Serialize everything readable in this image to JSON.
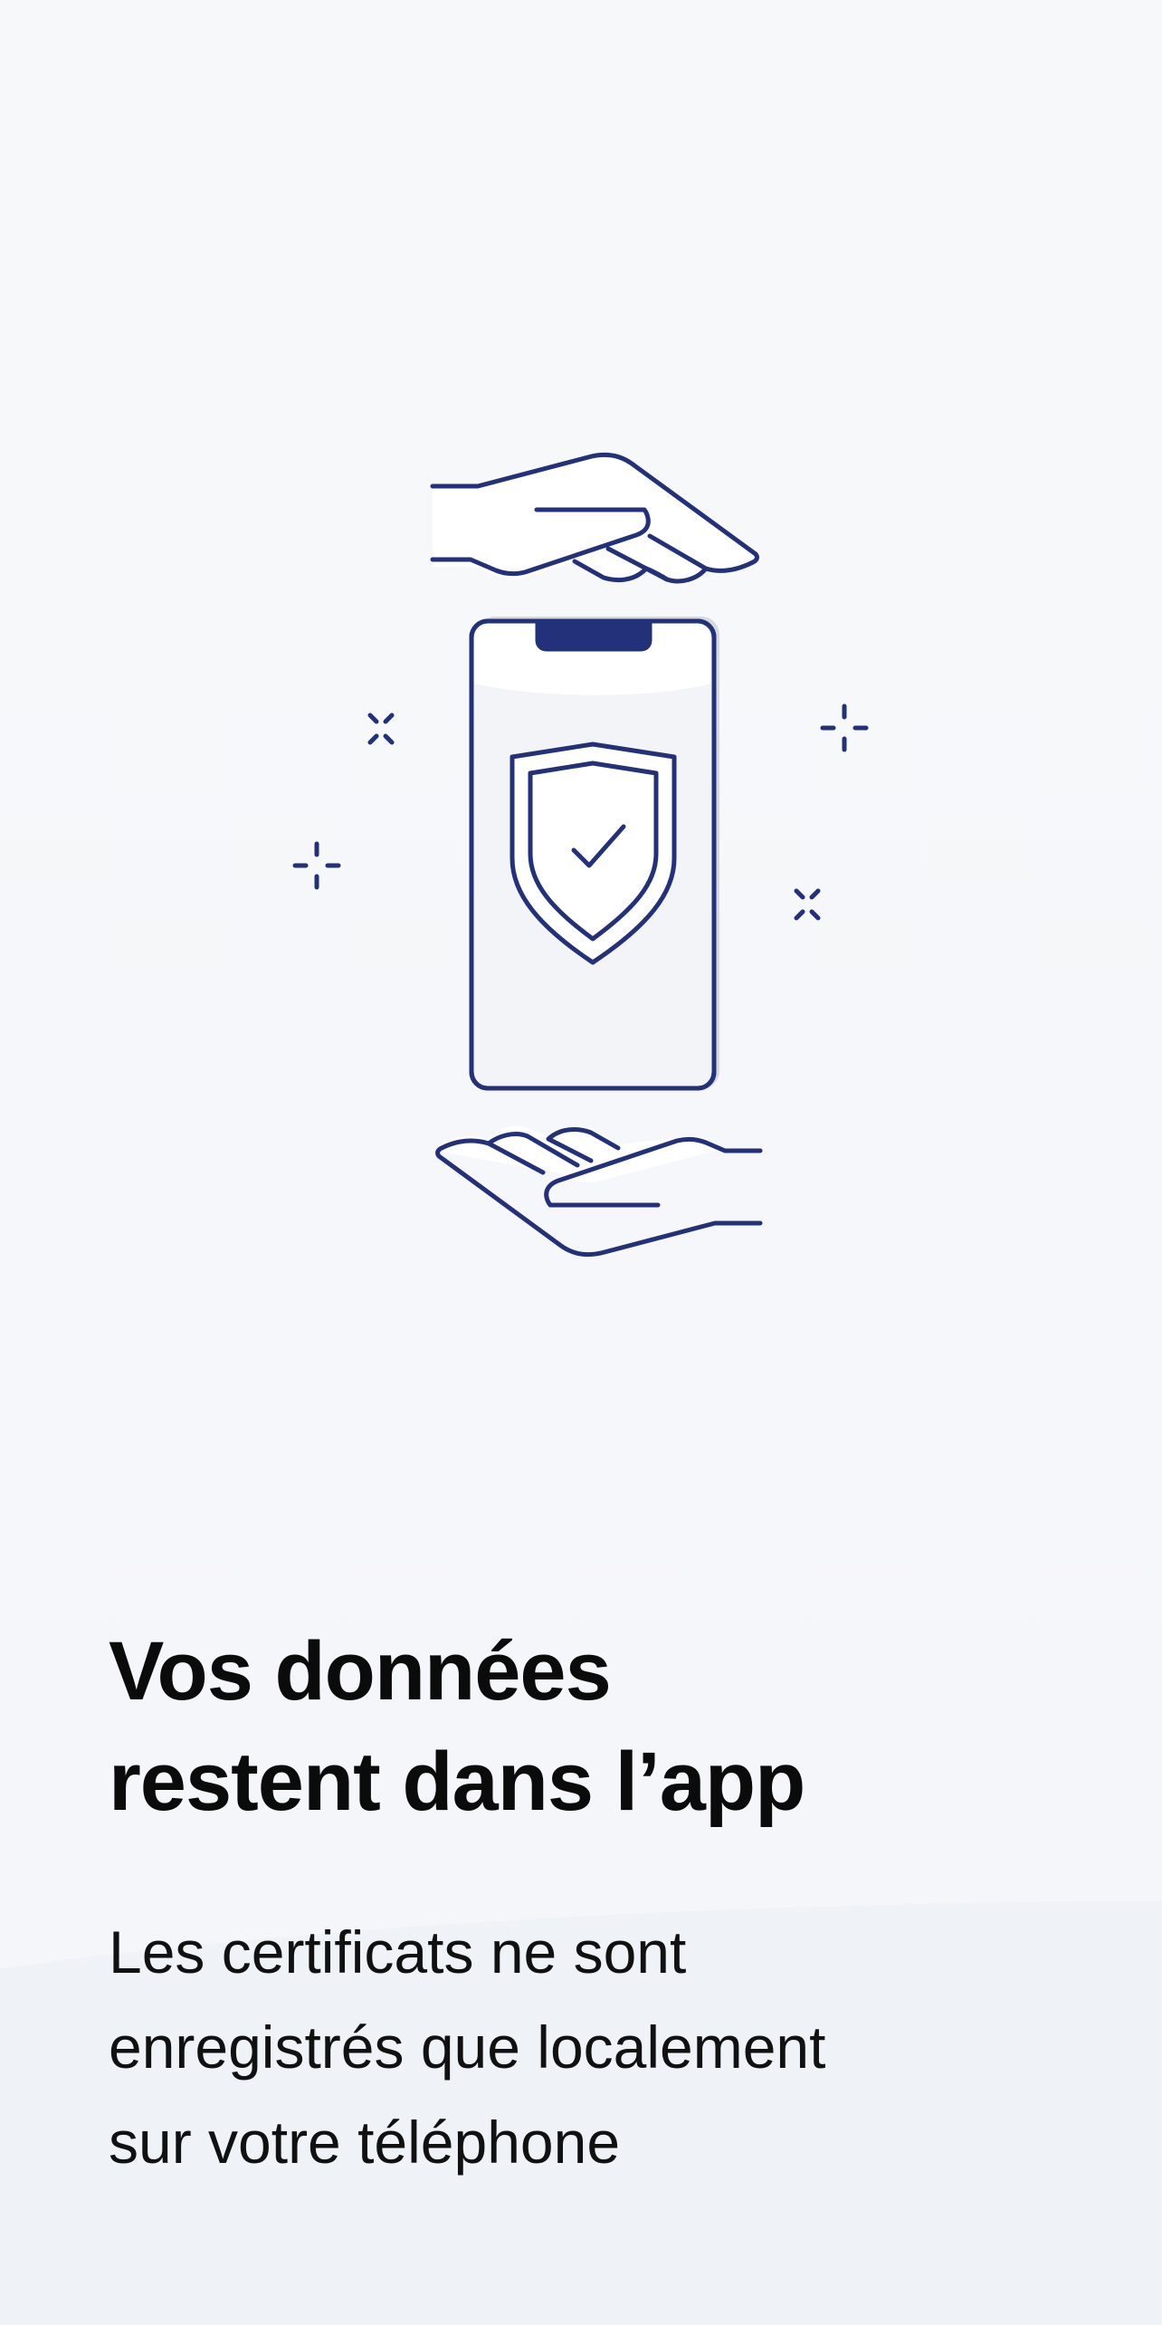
{
  "onboarding": {
    "title_line1": "Vos données",
    "title_line2": "restent dans l’app",
    "description_line1": "Les certificats ne sont",
    "description_line2": "enregistrés que localement",
    "description_line3": "sur votre téléphone"
  },
  "illustration": {
    "icons": [
      "hand-top-icon",
      "phone-icon",
      "shield-check-icon",
      "hand-bottom-icon",
      "sparkle-icon"
    ]
  },
  "colors": {
    "stroke": "#23307a",
    "phone_screen": "#f3f4f8",
    "background": "#f7f8fa",
    "title": "#0b0b0b"
  }
}
